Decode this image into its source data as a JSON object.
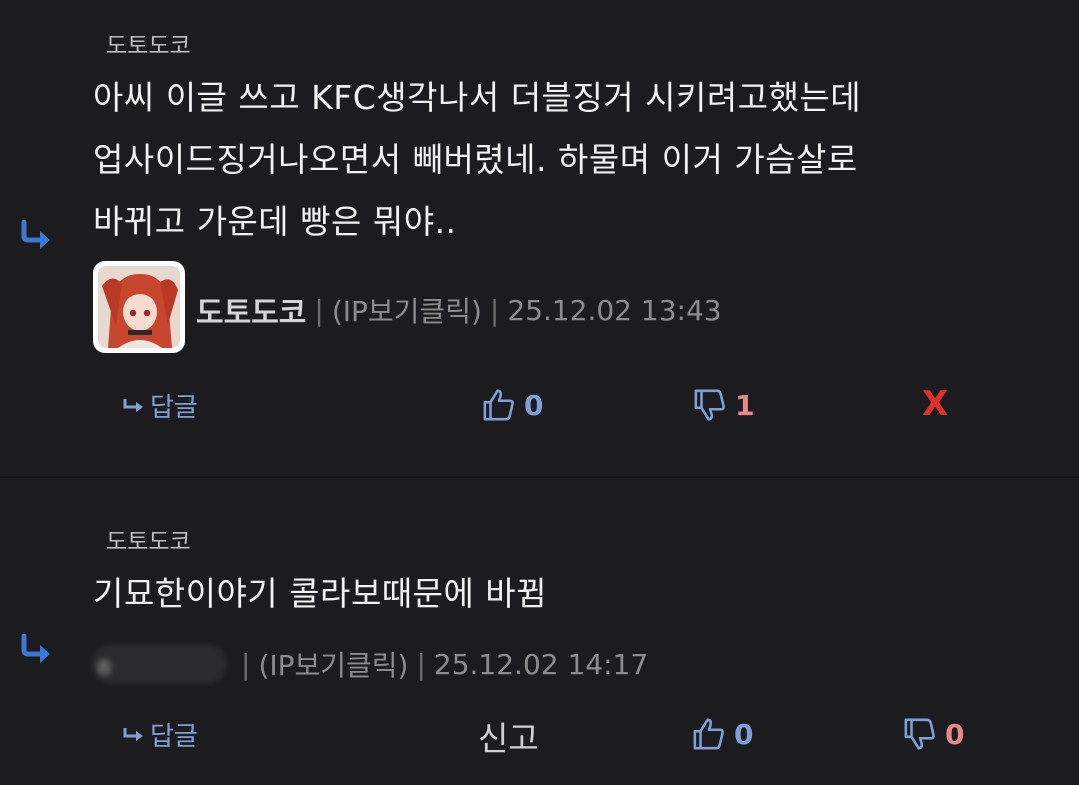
{
  "comments": [
    {
      "reply_to": "도토도코",
      "lines": [
        "아씨 이글 쓰고 KFC생각나서 더블징거 시키려고했는데",
        "업사이드징거나오면서 빼버렸네. 하물며 이거 가슴살로",
        "바뀌고 가운데 빵은 뭐야.."
      ],
      "nickname": "도토도코",
      "ip_label": "(IP보기클릭)",
      "timestamp": "25.12.02 13:43",
      "reply_label": "답글",
      "likes": "0",
      "dislikes": "1",
      "delete_label": "X"
    },
    {
      "reply_to": "도토도코",
      "lines": [
        "기묘한이야기 콜라보때문에 바뀜"
      ],
      "nickname_peek": "ㅎ",
      "ip_label": "(IP보기클릭)",
      "timestamp": "25.12.02 14:17",
      "reply_label": "답글",
      "report_label": "신고",
      "likes": "0",
      "dislikes": "0"
    }
  ],
  "colors": {
    "background": "#1c1c1e",
    "accent_blue": "#7ea0d8",
    "dislike_red": "#e58a8a",
    "delete_red": "#e0302a",
    "reply_arrow_blue": "#3a78d6"
  },
  "icons": [
    "reply-arrow-icon",
    "thumbs-up-icon",
    "thumbs-down-icon",
    "avatar-image"
  ]
}
